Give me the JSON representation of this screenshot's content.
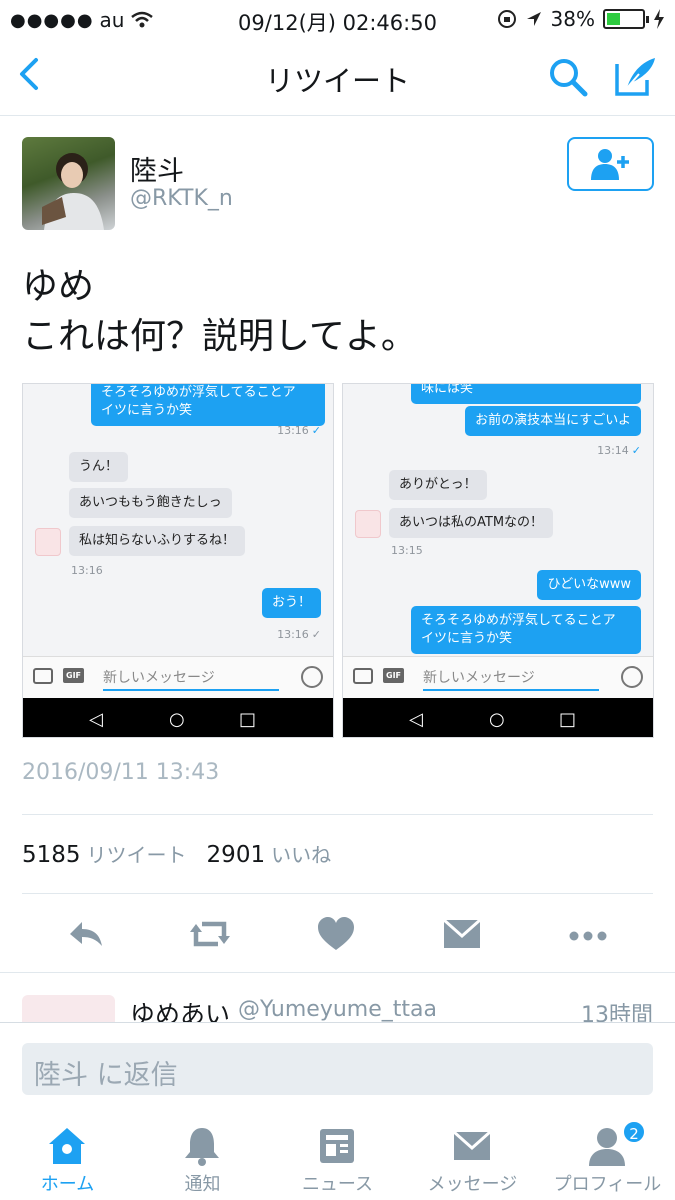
{
  "status_bar": {
    "carrier": "au",
    "time": "09/12(月) 02:46:50",
    "battery_percent": "38%",
    "battery_level": 0.38
  },
  "nav": {
    "title": "リツイート"
  },
  "tweet": {
    "author_name": "陸斗",
    "author_handle": "@RKTK_n",
    "text": "ゆめ\nこれは何？説明してよ。",
    "date": "2016/09/11 13:43",
    "retweet_count": "5185",
    "retweet_label": "リツイート",
    "like_count": "2901",
    "like_label": "いいね"
  },
  "media1": {
    "b1": "そろそろゆめが浮気してることア",
    "b1b": "イツに言うか笑",
    "t1": "13:16",
    "b2": "うん！",
    "b3": "あいつももう飽きたしっ",
    "b4": "私は知らないふりするね！",
    "t2": "13:16",
    "b5": "おう！",
    "t3": "13:16",
    "placeholder": "新しいメッセージ",
    "gif": "GIF"
  },
  "media2": {
    "b1": "味には笑",
    "b2": "お前の演技本当にすごいよ",
    "t1": "13:14",
    "b3": "ありがとっ！",
    "b4": "あいつは私のATMなの！",
    "t2": "13:15",
    "b5": "ひどいなwww",
    "b6": "そろそろゆめが浮気してることア",
    "b6b": "イツに言うか笑",
    "placeholder": "新しいメッセージ",
    "gif": "GIF"
  },
  "reply_preview": {
    "name": "ゆめあい",
    "handle": "@Yumeyume_ttaa",
    "time": "13時間"
  },
  "reply_box": {
    "placeholder": "陸斗 に返信"
  },
  "tabs": [
    {
      "label": "ホーム",
      "icon": "home-icon"
    },
    {
      "label": "通知",
      "icon": "bell-icon"
    },
    {
      "label": "ニュース",
      "icon": "news-icon"
    },
    {
      "label": "メッセージ",
      "icon": "envelope-icon"
    },
    {
      "label": "プロフィール",
      "icon": "profile-icon",
      "badge": "2"
    }
  ],
  "colors": {
    "accent": "#1da1f2",
    "muted": "#8899a6",
    "icon_gray": "#8899a6"
  }
}
